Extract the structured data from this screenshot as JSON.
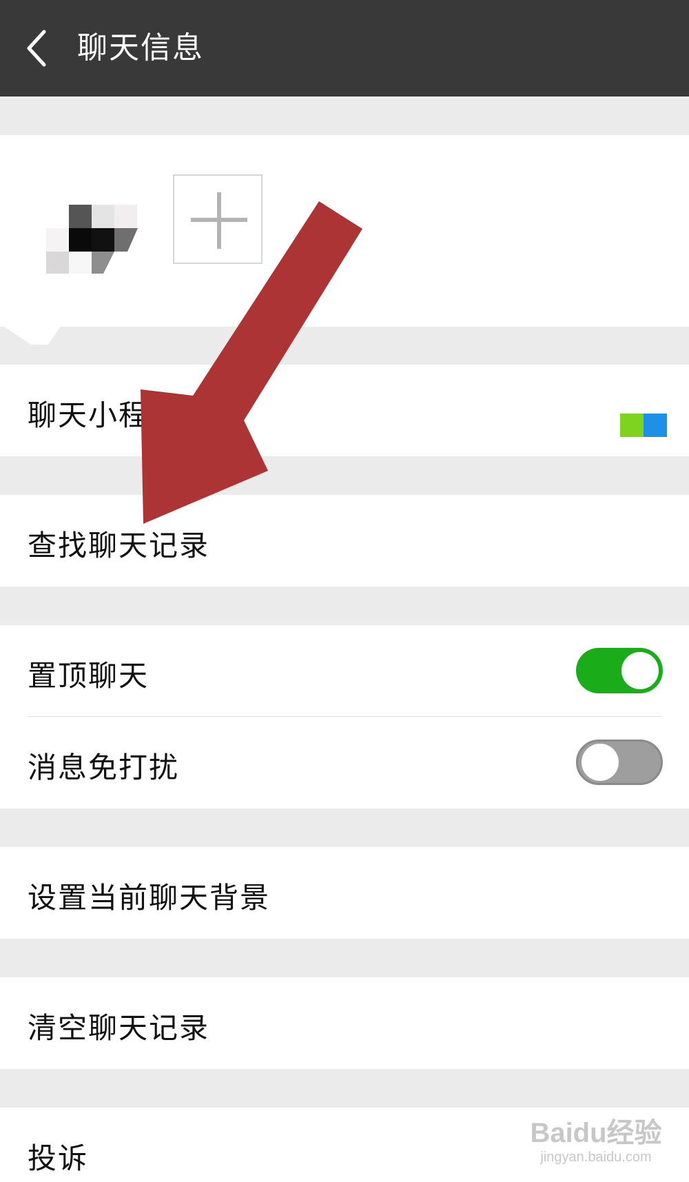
{
  "header": {
    "title": "聊天信息",
    "back_icon": "chevron-left-icon"
  },
  "members": {
    "add_icon": "plus-icon"
  },
  "rows": {
    "mini_programs": "聊天小程",
    "search_history": "查找聊天记录",
    "sticky_chat": "置顶聊天",
    "mute": "消息免打扰",
    "set_background": "设置当前聊天背景",
    "clear_history": "清空聊天记录",
    "report": "投诉"
  },
  "toggles": {
    "sticky_chat_on": true,
    "mute_on": false
  },
  "colors": {
    "header_bg": "#393939",
    "toggle_on": "#1aad19",
    "toggle_off": "#9e9e9e",
    "arrow": "#ad3434",
    "mini_icon_green": "#7ed321",
    "mini_icon_blue": "#1e90e8"
  },
  "watermark": {
    "logo": "Baidu经验",
    "url": "jingyan.baidu.com"
  }
}
